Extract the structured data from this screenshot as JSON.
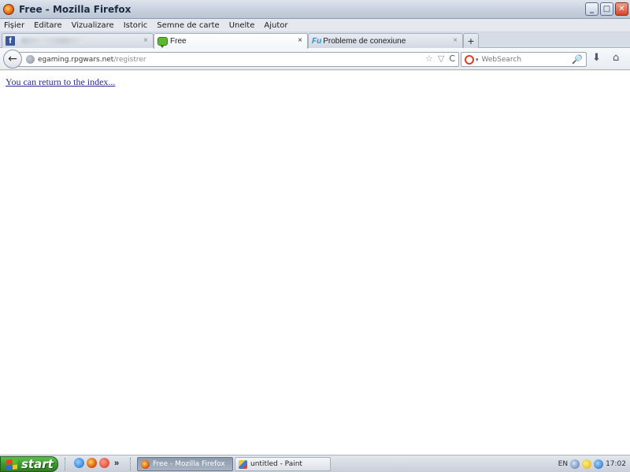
{
  "window": {
    "title": "Free - Mozilla Firefox",
    "buttons": {
      "minimize": "_",
      "maximize": "□",
      "close": "✕"
    }
  },
  "menu": [
    "Fișier",
    "Editare",
    "Vizualizare",
    "Istoric",
    "Semne de carte",
    "Unelte",
    "Ajutor"
  ],
  "tabs": [
    {
      "label": "",
      "icon": "facebook-icon",
      "close": "×"
    },
    {
      "label": "Free",
      "icon": "chat-bubble-icon",
      "close": "×"
    },
    {
      "label": "Probleme de conexiune",
      "icon": "fu-forum-icon",
      "icon_text": "Fu",
      "close": "×"
    }
  ],
  "new_tab_label": "+",
  "navbar": {
    "back": "←",
    "url_host": "egaming.rpgwars.net",
    "url_path": "/registrer",
    "bookmark_star": "☆",
    "history_dropdown": "▽",
    "reload": "C",
    "search_placeholder": "WebSearch",
    "search_dropdown": "▾",
    "search_glass": "🔎",
    "download": "⬇",
    "home": "⌂"
  },
  "content": {
    "link_text": "You can return to the index..."
  },
  "taskbar": {
    "start_label": "start",
    "quicklaunch_more": "»",
    "buttons": [
      {
        "label": "Free - Mozilla Firefox",
        "active": true
      },
      {
        "label": "untitled - Paint",
        "active": false
      }
    ],
    "tray": {
      "lang": "EN",
      "time": "17:02"
    }
  },
  "colors": {
    "link": "#2b2a9a",
    "start_green": "#3d9a2f",
    "facebook_blue": "#3b5998"
  }
}
